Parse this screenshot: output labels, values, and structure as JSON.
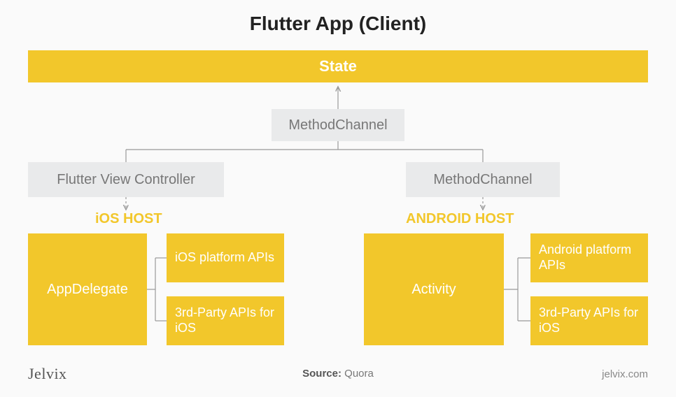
{
  "title": "Flutter App (Client)",
  "state": "State",
  "method_top": "MethodChannel",
  "flutter_vc": "Flutter View Controller",
  "method_right": "MethodChannel",
  "ios_host": "iOS HOST",
  "android_host": "ANDROID HOST",
  "appdelegate": "AppDelegate",
  "ios_apis": "iOS platform APIs",
  "ios_3rd": "3rd-Party APIs for iOS",
  "activity": "Activity",
  "android_apis": "Android platform APIs",
  "android_3rd": "3rd-Party APIs for iOS",
  "source_label": "Source:",
  "source_name": "Quora",
  "jelvix_logo": "Jelvix",
  "jelvix_url": "jelvix.com"
}
